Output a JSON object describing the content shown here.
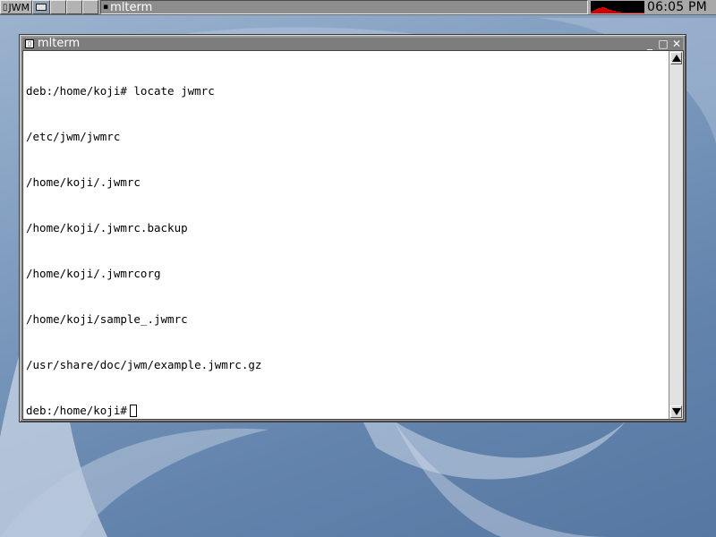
{
  "taskbar": {
    "menu_label": "JWM",
    "desktops": [
      "desktop-1",
      "desktop-2",
      "desktop-3",
      "desktop-4"
    ],
    "active_desktop": 1,
    "task_label": "mlterm",
    "clock": "06:05 PM",
    "load_graph_colors": {
      "fg": "#d00000",
      "bg": "#000000"
    }
  },
  "window": {
    "title": "mlterm",
    "buttons": {
      "minimize": "_",
      "maximize": "□",
      "close": "✕"
    }
  },
  "terminal": {
    "lines": [
      "deb:/home/koji# locate jwmrc",
      "/etc/jwm/jwmrc",
      "/home/koji/.jwmrc",
      "/home/koji/.jwmrc.backup",
      "/home/koji/.jwmrcorg",
      "/home/koji/sample_.jwmrc",
      "/usr/share/doc/jwm/example.jwmrc.gz"
    ],
    "prompt": "deb:/home/koji#"
  },
  "colors": {
    "desktop_bg": "#7f9cbf",
    "titlebar": "#7d7d7d",
    "taskbar": "#a8a8a8"
  }
}
